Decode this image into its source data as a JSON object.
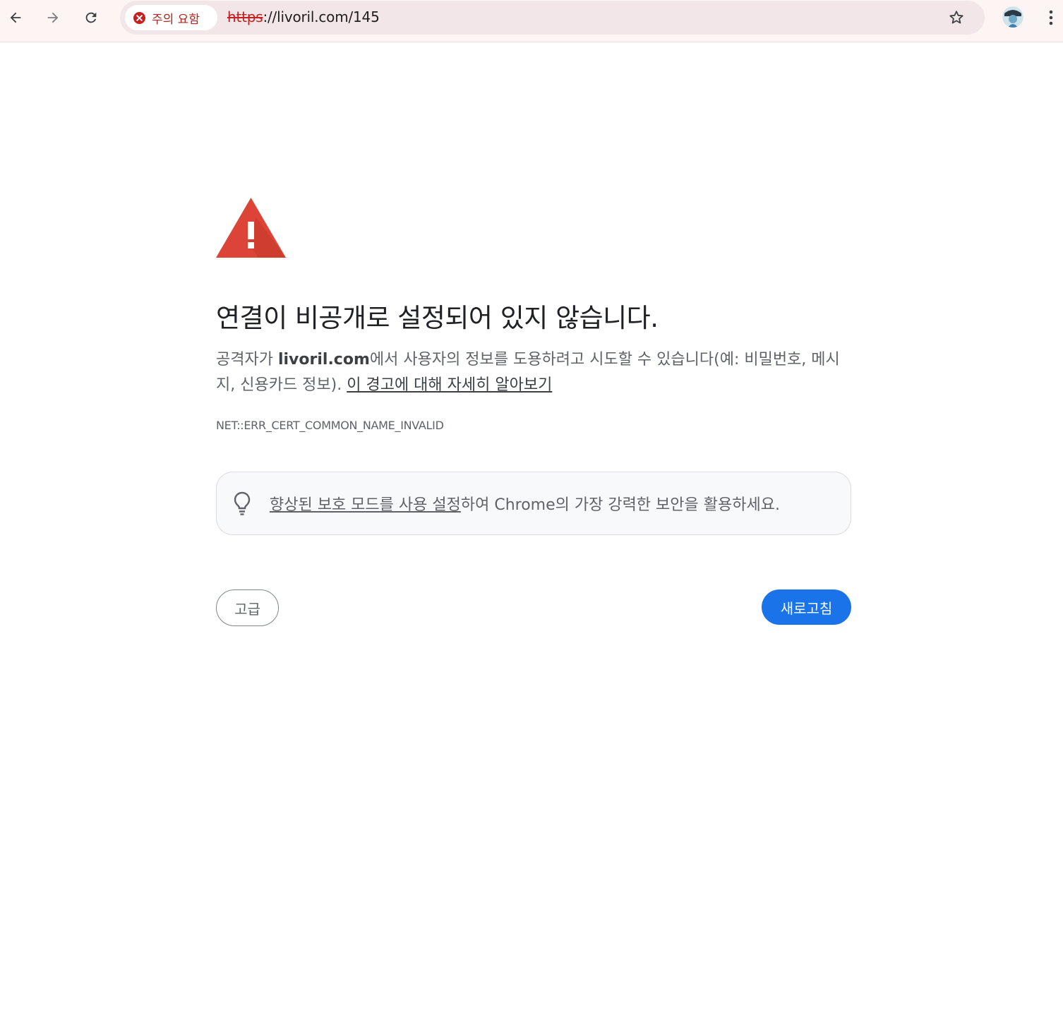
{
  "browser": {
    "security_chip_label": "주의 요함",
    "url_scheme": "https",
    "url_rest": "://livoril.com/145"
  },
  "page": {
    "headline": "연결이 비공개로 설정되어 있지 않습니다.",
    "desc_prefix": "공격자가 ",
    "desc_host": "livoril.com",
    "desc_suffix": "에서 사용자의 정보를 도용하려고 시도할 수 있습니다(예: 비밀번호, 메시지, 신용카드 정보). ",
    "learn_more_link": "이 경고에 대해 자세히 알아보기",
    "error_code": "NET::ERR_CERT_COMMON_NAME_INVALID",
    "promo_link": "향상된 보호 모드를 사용 설정",
    "promo_suffix": "하여 Chrome의 가장 강력한 보안을 활용하세요.",
    "advanced_button": "고급",
    "reload_button": "새로고침"
  },
  "colors": {
    "danger": "#c5221f",
    "primary_button": "#1a73e8",
    "warning_triangle": "#db4437"
  }
}
